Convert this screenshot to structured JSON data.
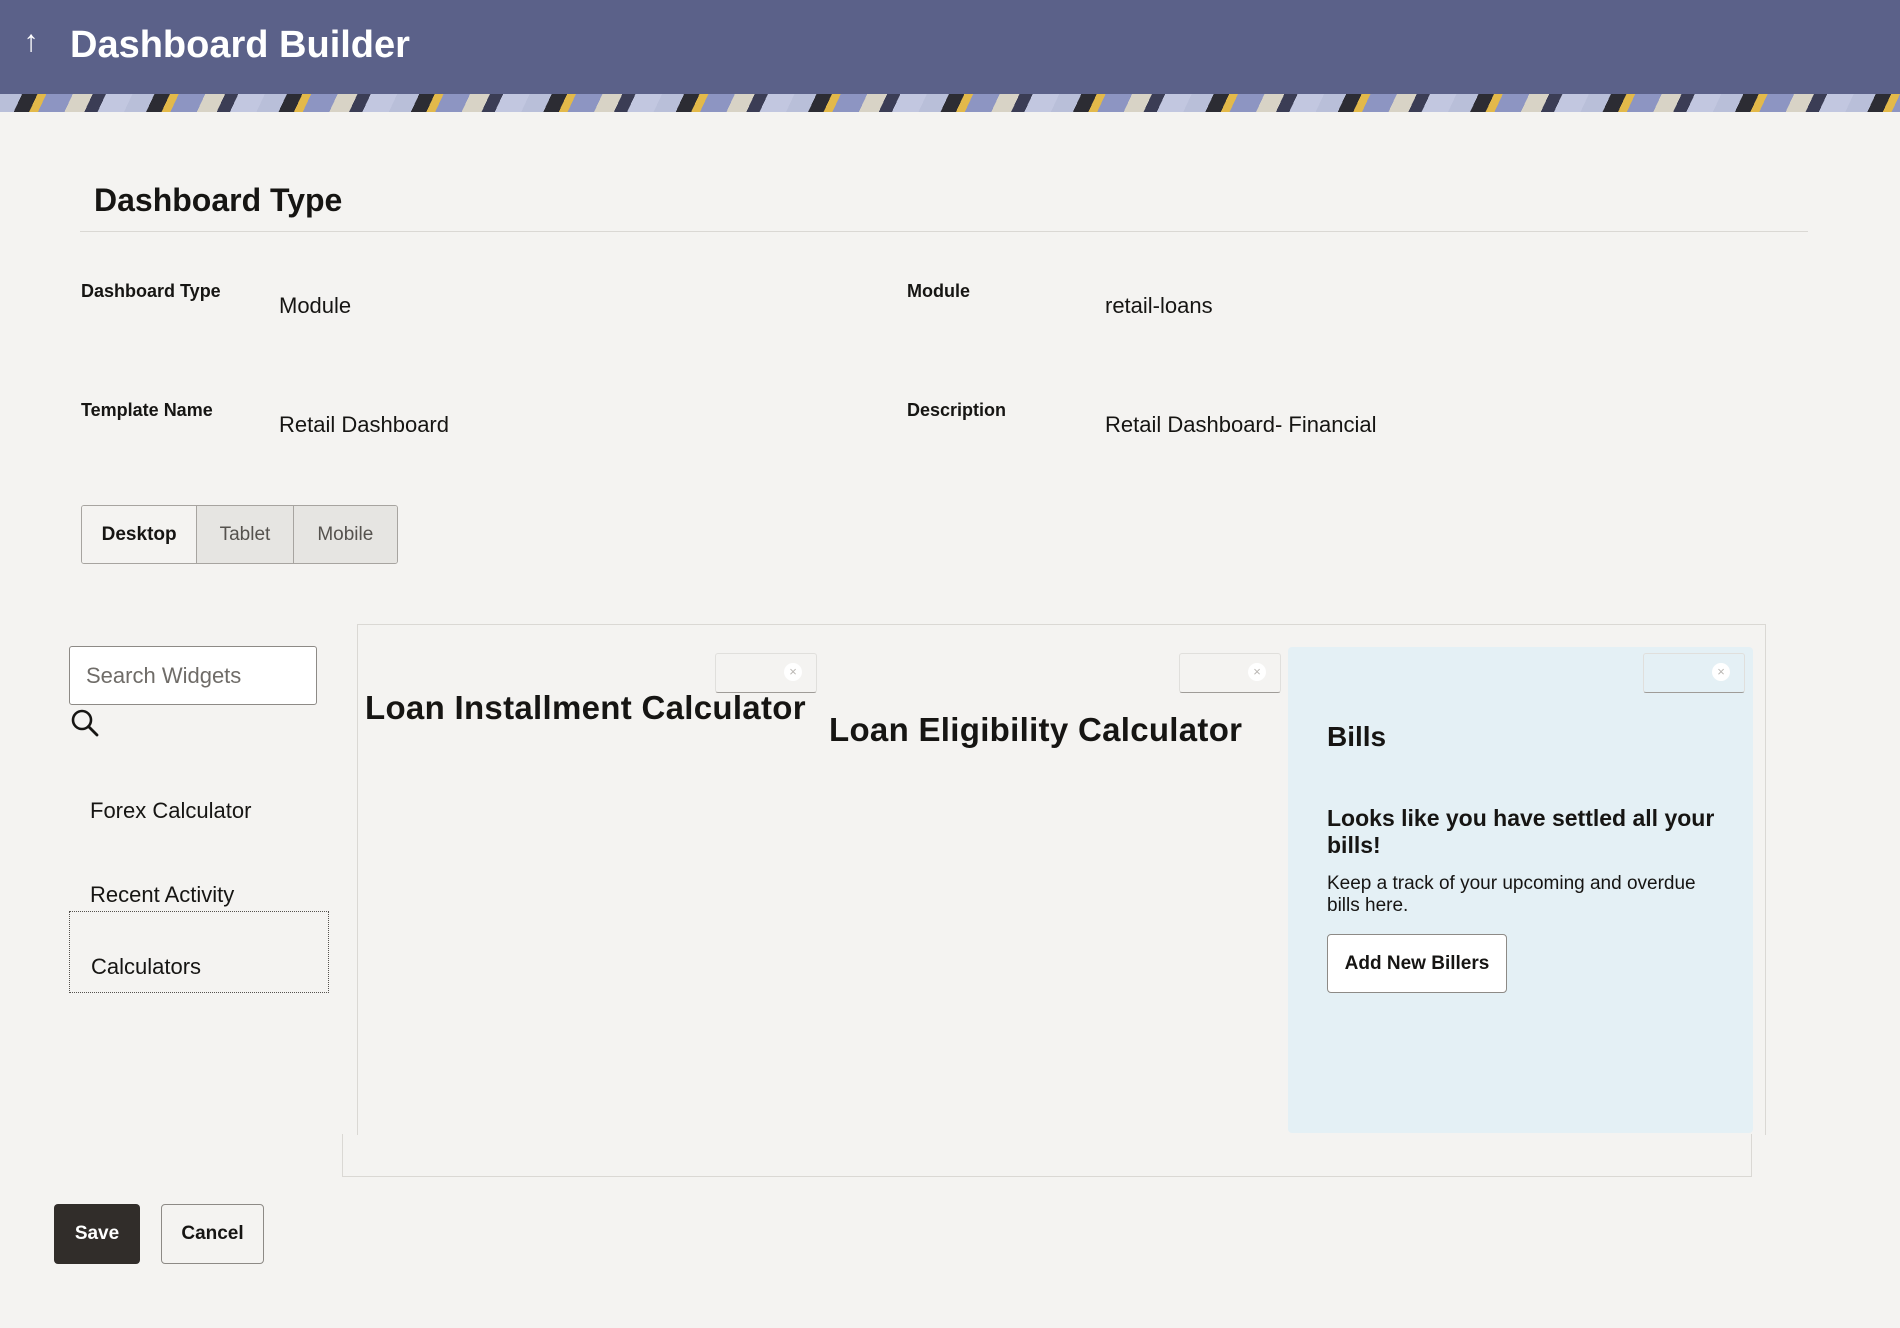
{
  "header": {
    "title": "Dashboard Builder",
    "back_icon": "arrow-up-icon"
  },
  "section": {
    "title": "Dashboard Type"
  },
  "fields": {
    "dashboard_type": {
      "label": "Dashboard Type",
      "value": "Module"
    },
    "module": {
      "label": "Module",
      "value": "retail-loans"
    },
    "template_name": {
      "label": "Template Name",
      "value": "Retail Dashboard"
    },
    "description": {
      "label": "Description",
      "value": "Retail Dashboard- Financial"
    }
  },
  "device_tabs": {
    "options": [
      "Desktop",
      "Tablet",
      "Mobile"
    ],
    "selected": "Desktop"
  },
  "widget_search": {
    "placeholder": "Search Widgets",
    "icon": "search-icon"
  },
  "widget_list": [
    {
      "label": "Forex Calculator"
    },
    {
      "label": "Recent Activity"
    },
    {
      "label": "Calculators",
      "selected": true
    }
  ],
  "canvas": {
    "widgets": [
      {
        "title": "Loan Installment Calculator"
      },
      {
        "title": "Loan Eligibility Calculator"
      },
      {
        "title": "Bills",
        "message": "Looks like you have settled all your bills!",
        "subtext": "Keep a track of your upcoming and overdue bills here.",
        "button": "Add New Billers"
      }
    ],
    "close_glyph": "×"
  },
  "actions": {
    "save": "Save",
    "cancel": "Cancel"
  },
  "colors": {
    "header_bg": "#5b6189",
    "page_bg": "#f4f3f1",
    "primary_button": "#312d2a",
    "bills_card_bg": "#e4f0f5"
  }
}
